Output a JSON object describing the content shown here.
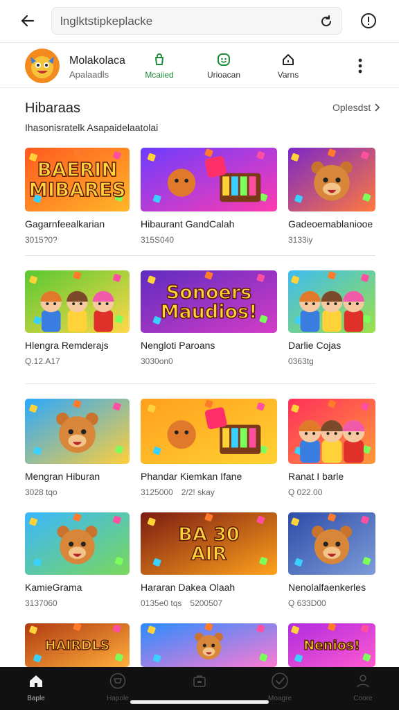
{
  "browser": {
    "url": "lnglktstipkeplacke"
  },
  "app": {
    "title": "Molakolaca",
    "subtitle": "Apalaadls"
  },
  "header_tabs": [
    {
      "label": "Mcaiied",
      "icon": "store-icon",
      "active": true
    },
    {
      "label": "Urioacan",
      "icon": "smile-icon",
      "active": false
    },
    {
      "label": "Varns",
      "icon": "home-icon",
      "active": false
    }
  ],
  "section": {
    "title": "Hibaraas",
    "link": "Oplesdst",
    "subtitle": "Ihasonisratelk Asapaidelaatolai"
  },
  "rows": [
    [
      {
        "title": "Gagarnfeealkarian",
        "meta": "3015?0?",
        "art": "text",
        "art_text": "BAERIN MIBARES",
        "colors": [
          "#ff5a1f",
          "#ffb629"
        ]
      },
      {
        "title": "Hibaurant GandCalah",
        "meta": "315S040",
        "art": "blocks",
        "colors": [
          "#6c3cff",
          "#ff3bb0"
        ]
      },
      {
        "title": "Gadeoemablaniooe",
        "meta": "3133iy",
        "art": "bear",
        "colors": [
          "#7a28c8",
          "#ff7a3c"
        ]
      }
    ],
    [
      {
        "title": "Hlengra Remderajs",
        "meta": "Q.12.A17",
        "art": "kids",
        "colors": [
          "#58c832",
          "#ffd84a"
        ]
      },
      {
        "title": "Nengloti Paroans",
        "meta": "3030on0",
        "art": "text",
        "art_text": "Sonoers Maudios!",
        "colors": [
          "#5e2cc0",
          "#d43cc6"
        ]
      },
      {
        "title": "Darlie Cojas",
        "meta": "0363tg",
        "art": "kids",
        "colors": [
          "#3cbcf0",
          "#9de04a"
        ]
      }
    ],
    [
      {
        "title": "Mengran Hiburan",
        "meta": "3028 tqo",
        "art": "bear",
        "colors": [
          "#2aa8ff",
          "#ffcf3a"
        ]
      },
      {
        "title": "Phandar Kiemkan Ifane",
        "meta": "3125000",
        "meta2": "2/2! skay",
        "art": "blocks",
        "colors": [
          "#ff9f1c",
          "#ffd233"
        ]
      },
      {
        "title": "Ranat I barle",
        "meta": "Q 022.00",
        "art": "kids",
        "colors": [
          "#ff2f5a",
          "#ff9a3a"
        ]
      }
    ],
    [
      {
        "title": "KamieGrama",
        "meta": "3137060",
        "art": "bear",
        "colors": [
          "#3ab6ff",
          "#7ad85a"
        ]
      },
      {
        "title": "Hararan Dakea Olaah",
        "meta": "0135e0 tqs",
        "meta2": "5200507",
        "art": "text",
        "art_text": "BA 30 AIR",
        "colors": [
          "#7a1c12",
          "#ffa21c"
        ]
      },
      {
        "title": "Nenolalfaenkerles",
        "meta": "Q 633D00",
        "art": "bear",
        "colors": [
          "#2c4ca8",
          "#7e9cd8"
        ]
      }
    ],
    [
      {
        "title": "",
        "meta": "",
        "art": "text",
        "art_text": "HAIRDLS",
        "colors": [
          "#b03a12",
          "#ffb03c"
        ]
      },
      {
        "title": "",
        "meta": "",
        "art": "bear",
        "colors": [
          "#2a8cff",
          "#ff7ad2"
        ]
      },
      {
        "title": "",
        "meta": "",
        "art": "text",
        "art_text": "Nenios!",
        "colors": [
          "#b02ce0",
          "#ff5ad0"
        ]
      }
    ]
  ],
  "bottom_nav": [
    {
      "label": "Baple",
      "icon": "home-icon",
      "active": true
    },
    {
      "label": "Hapole",
      "icon": "cart-icon",
      "active": false
    },
    {
      "label": "",
      "icon": "bag-icon",
      "active": false
    },
    {
      "label": "Moagre",
      "icon": "check-icon",
      "active": false
    },
    {
      "label": "Coore",
      "icon": "user-icon",
      "active": false
    }
  ]
}
